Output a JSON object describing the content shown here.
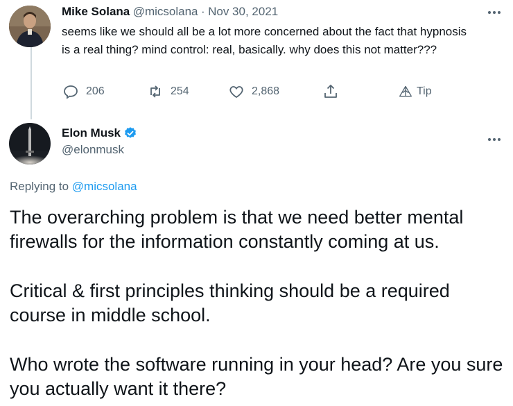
{
  "first_tweet": {
    "author_name": "Mike Solana",
    "handle": "@micsolana",
    "separator": "·",
    "date": "Nov 30, 2021",
    "text": "seems like we should all be a lot more concerned about the fact that hypnosis is a real thing? mind control: real, basically. why does this not matter???",
    "actions": {
      "replies": "206",
      "retweets": "254",
      "likes": "2,868",
      "tip_label": "Tip"
    }
  },
  "second_tweet": {
    "author_name": "Elon Musk",
    "handle": "@elonmusk",
    "replying_prefix": "Replying to ",
    "replying_to": "@micsolana",
    "paragraphs": [
      "The overarching problem is that we need better mental firewalls for the information constantly coming at us.",
      "Critical & first principles thinking should be a required course in middle school.",
      "Who wrote the software running in your head? Are you sure you actually want it there?"
    ]
  },
  "colors": {
    "link": "#1d9bf0",
    "verified": "#1d9bf0",
    "secondary_text": "#536471",
    "thread_line": "#cfd9de"
  },
  "icons": [
    "more-icon",
    "reply-icon",
    "retweet-icon",
    "like-icon",
    "share-icon",
    "tip-icon",
    "verified-badge-icon"
  ]
}
